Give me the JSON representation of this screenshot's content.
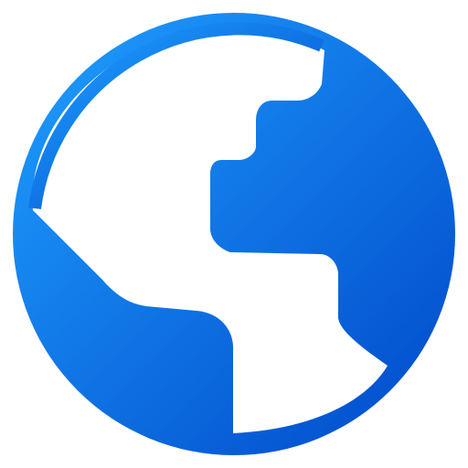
{
  "icon": {
    "name": "globe-icon",
    "colors": {
      "gradient_start": "#1FA0FF",
      "gradient_end": "#0047C9",
      "land": "#FFFFFF",
      "background": "#FFFFFF"
    }
  }
}
